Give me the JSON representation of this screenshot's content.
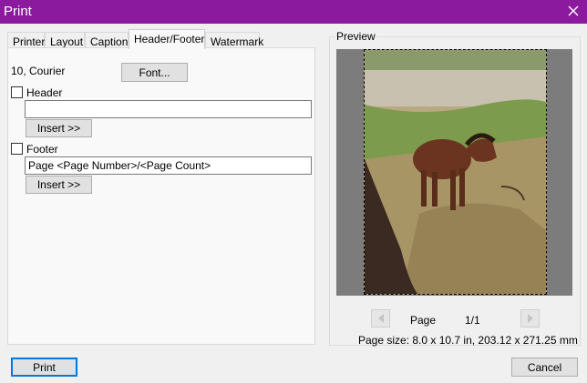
{
  "window": {
    "title": "Print",
    "close_label": "✕"
  },
  "tabs": [
    {
      "label": "Printer",
      "active": false
    },
    {
      "label": "Layout",
      "active": false
    },
    {
      "label": "Caption",
      "active": false
    },
    {
      "label": "Header/Footer",
      "active": true
    },
    {
      "label": "Watermark",
      "active": false
    }
  ],
  "font": {
    "current": "10, Courier",
    "button_label": "Font..."
  },
  "header": {
    "checkbox_label": "Header",
    "checked": false,
    "value": "",
    "insert_label": "Insert >>"
  },
  "footer": {
    "checkbox_label": "Footer",
    "checked": false,
    "value": "Page <Page Number>/<Page Count>",
    "insert_label": "Insert >>"
  },
  "preview": {
    "group_label": "Preview",
    "page_label": "Page",
    "page_counter": "1/1",
    "page_size": "Page size: 8.0 x 10.7 in, 203.12 x 271.25 mm"
  },
  "buttons": {
    "print_label": "Print",
    "cancel_label": "Cancel"
  },
  "colors": {
    "titlebar": "#8b1a9e",
    "accent_border": "#0078d7"
  }
}
